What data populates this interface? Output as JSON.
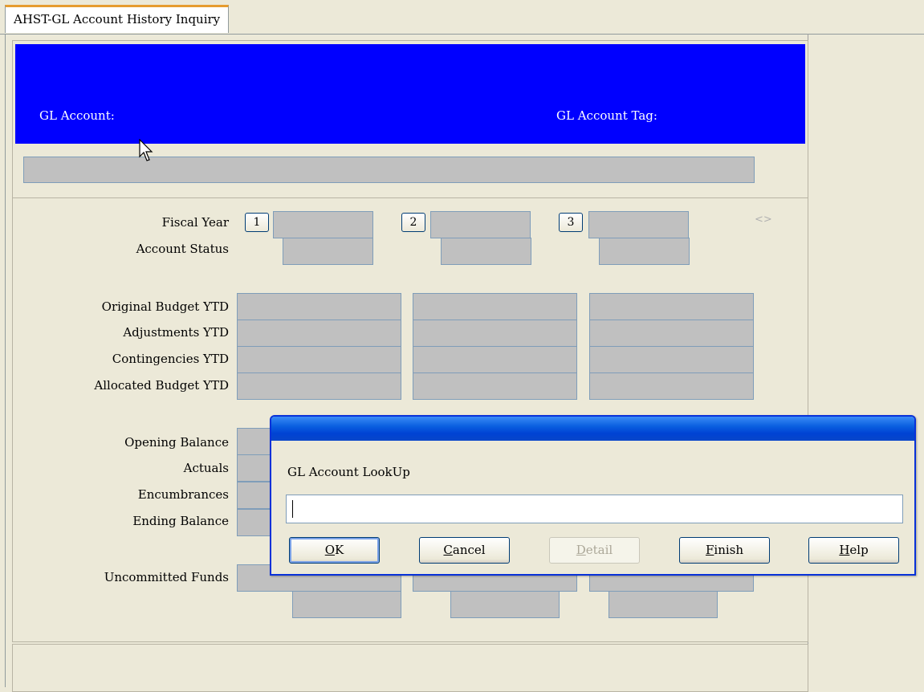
{
  "tab": {
    "title": "AHST-GL Account History Inquiry"
  },
  "header": {
    "gl_account_label": "GL Account:",
    "gl_account_tag_label": "GL Account Tag:"
  },
  "labels": {
    "fiscal_year": "Fiscal Year",
    "account_status": "Account Status",
    "original_budget_ytd": "Original Budget YTD",
    "adjustments_ytd": "Adjustments YTD",
    "contingencies_ytd": "Contingencies YTD",
    "allocated_budget_ytd": "Allocated Budget YTD",
    "opening_balance": "Opening Balance",
    "actuals": "Actuals",
    "encumbrances": "Encumbrances",
    "ending_balance": "Ending Balance",
    "uncommitted_funds": "Uncommitted Funds"
  },
  "year_buttons": [
    "1",
    "2",
    "3"
  ],
  "nav_arrows": "<>",
  "dialog": {
    "label": "GL Account LookUp",
    "input_value": "",
    "buttons": {
      "ok": "OK",
      "cancel": "Cancel",
      "detail": "Detail",
      "finish": "Finish",
      "help": "Help"
    }
  },
  "colors": {
    "header_bg": "#0000ff",
    "field_bg": "#c0c0c0",
    "window_bg": "#ece9d8",
    "title_bar": "#0a5fe0"
  }
}
